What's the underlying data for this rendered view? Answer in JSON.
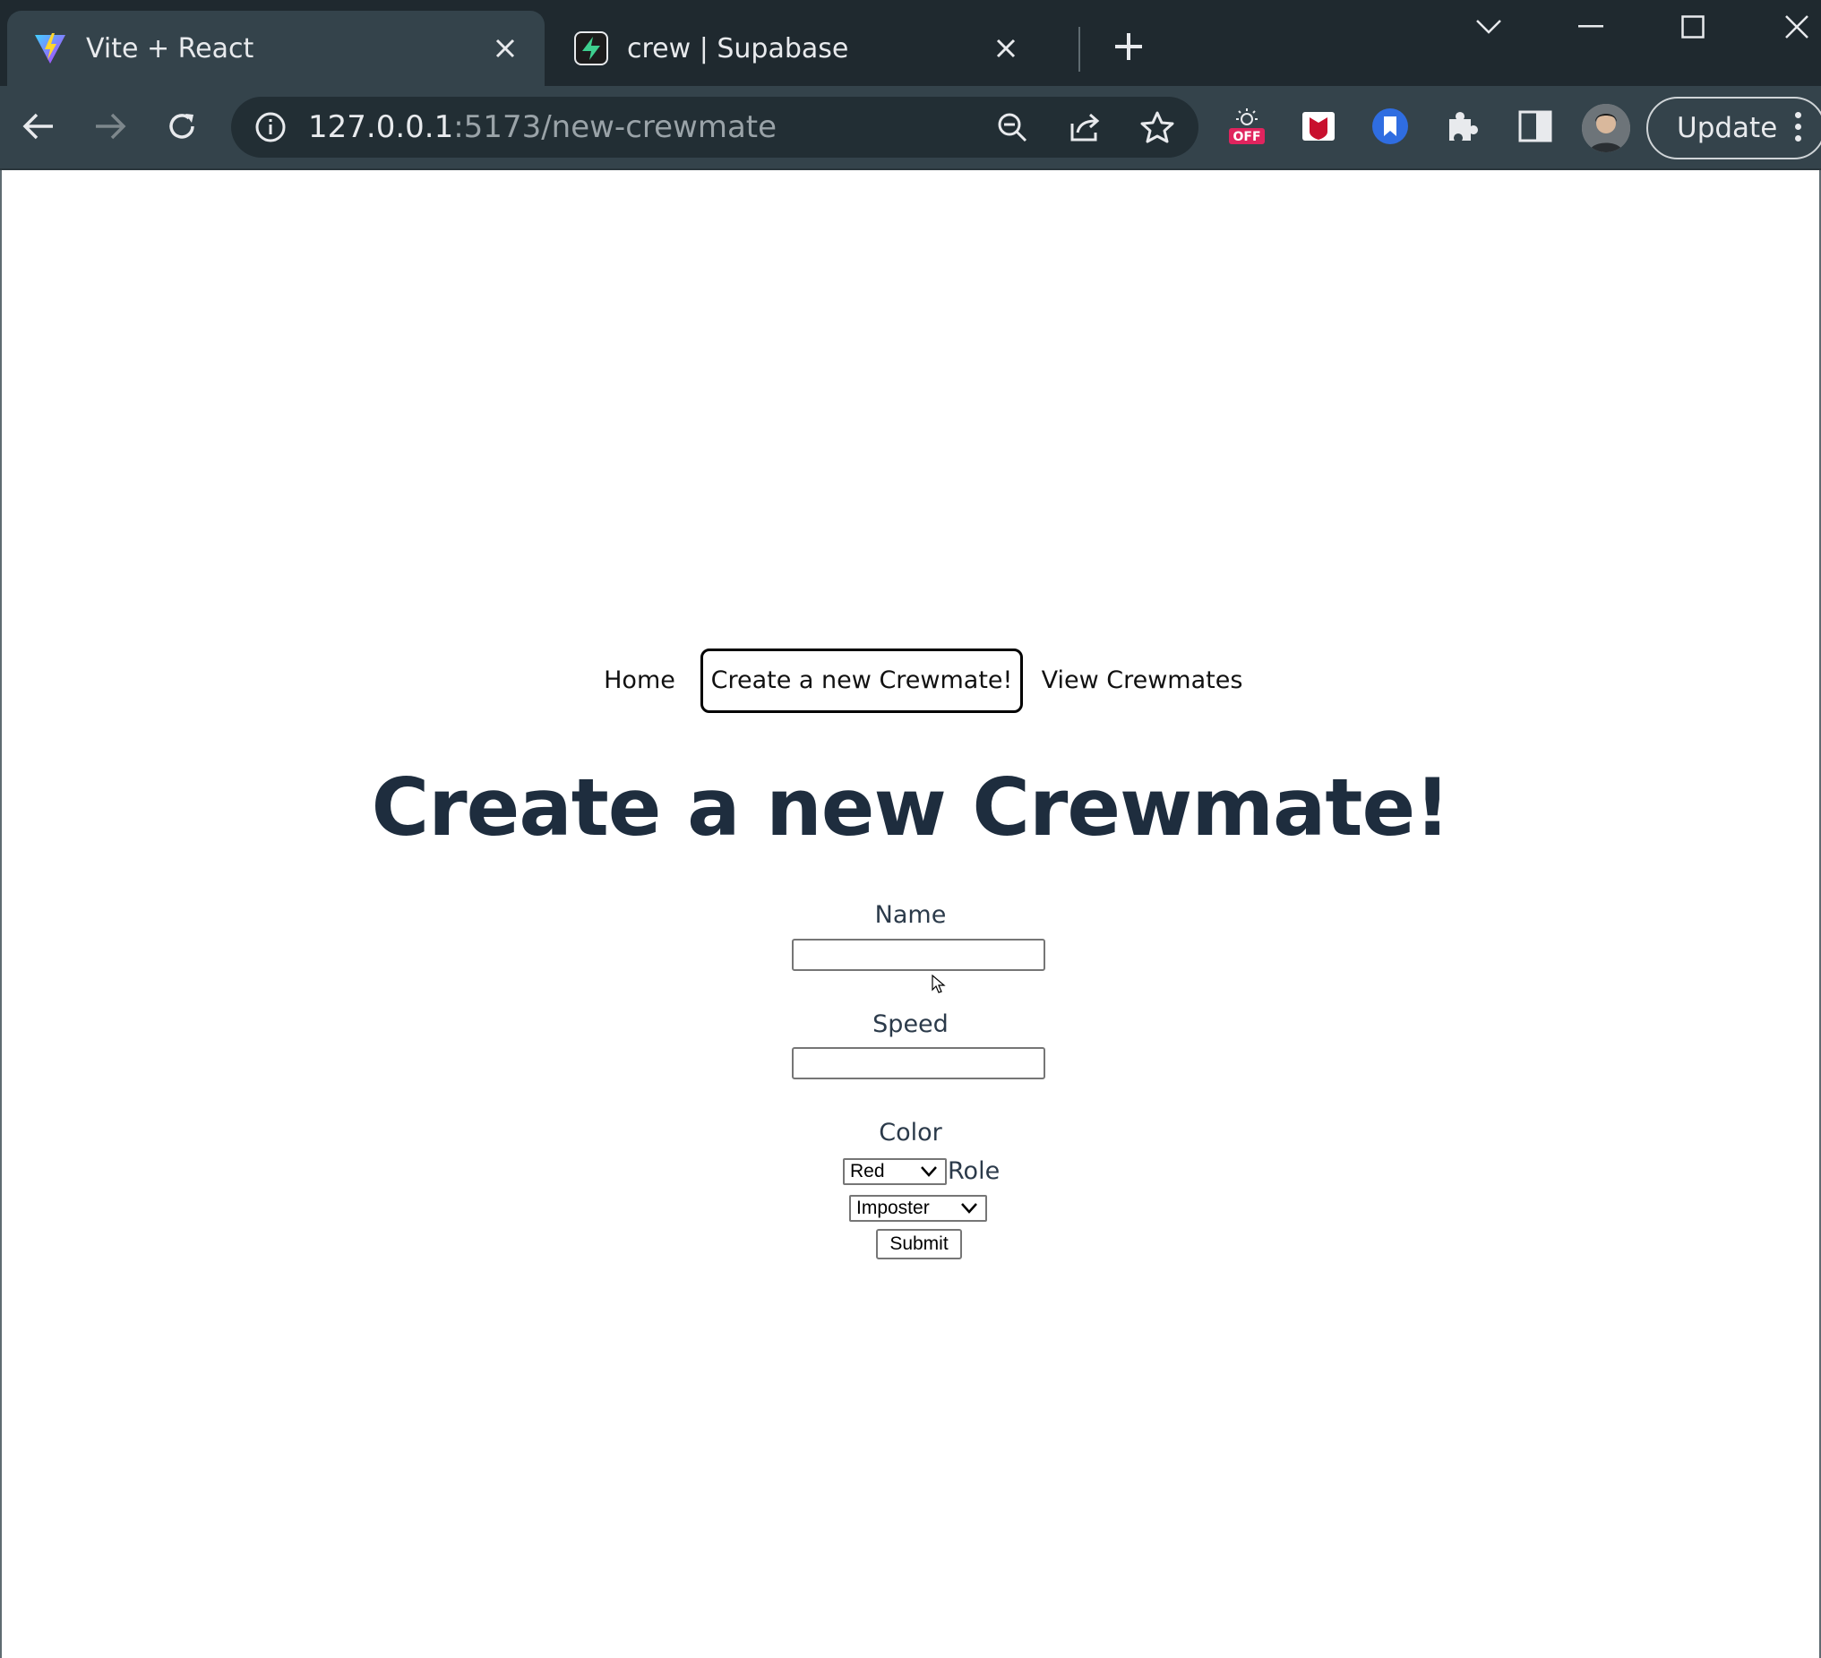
{
  "browser": {
    "tabs": [
      {
        "title": "Vite + React",
        "favicon": "vite-icon",
        "active": true
      },
      {
        "title": "crew | Supabase",
        "favicon": "supabase-icon",
        "active": false
      }
    ],
    "url_host": "127.0.0.1",
    "url_path": ":5173/new-crewmate",
    "update_label": "Update",
    "extension_badge": "OFF"
  },
  "nav": {
    "home": "Home",
    "create": "Create a new Crewmate!",
    "view": "View Crewmates"
  },
  "page": {
    "title": "Create a new Crewmate!"
  },
  "form": {
    "name_label": "Name",
    "name_value": "",
    "speed_label": "Speed",
    "speed_value": "",
    "color_label": "Color",
    "color_value": "Red",
    "role_label": "Role",
    "role_value": "Imposter",
    "submit_label": "Submit"
  },
  "colors": {
    "title": "#1e2d3e",
    "chrome_dark": "#1f292f",
    "chrome_toolbar": "#34434b"
  }
}
